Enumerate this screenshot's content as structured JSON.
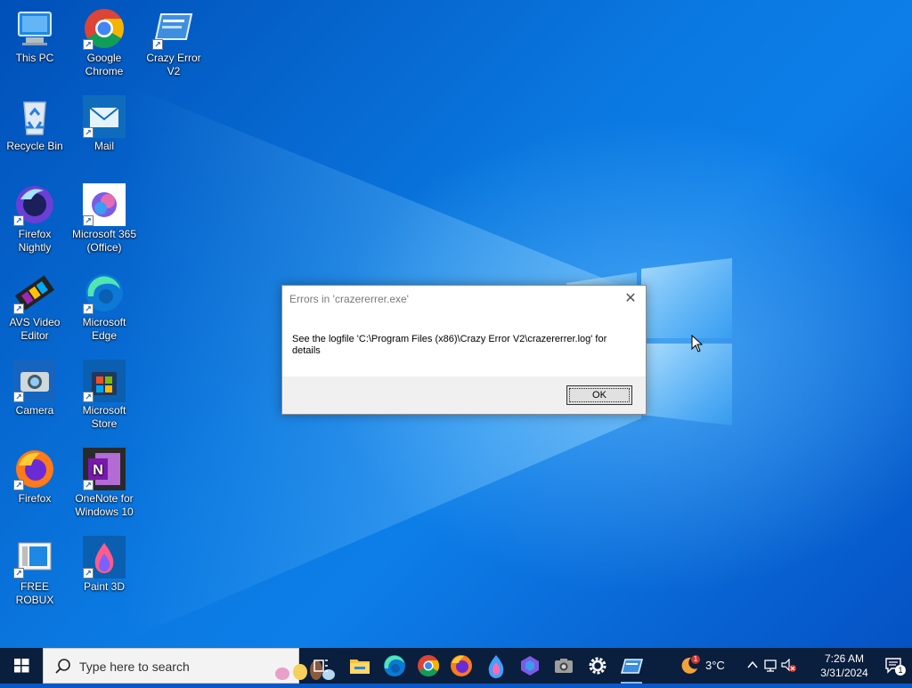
{
  "desktop": {
    "icons": [
      {
        "label": "This PC",
        "icon": "computer-icon",
        "shortcut": false
      },
      {
        "label": "Google Chrome",
        "icon": "chrome-icon",
        "shortcut": true
      },
      {
        "label": "Crazy Error V2",
        "icon": "crazy-error-icon",
        "shortcut": true
      },
      {
        "label": "Recycle Bin",
        "icon": "recycle-bin-icon",
        "shortcut": false
      },
      {
        "label": "Mail",
        "icon": "mail-icon",
        "shortcut": true
      },
      {
        "label": "Firefox Nightly",
        "icon": "firefox-nightly-icon",
        "shortcut": true
      },
      {
        "label": "Microsoft 365 (Office)",
        "icon": "office-icon",
        "shortcut": true
      },
      {
        "label": "AVS Video Editor",
        "icon": "film-icon",
        "shortcut": true
      },
      {
        "label": "Microsoft Edge",
        "icon": "edge-icon",
        "shortcut": true
      },
      {
        "label": "Camera",
        "icon": "camera-icon",
        "shortcut": true
      },
      {
        "label": "Microsoft Store",
        "icon": "store-icon",
        "shortcut": true
      },
      {
        "label": "Firefox",
        "icon": "firefox-icon",
        "shortcut": true
      },
      {
        "label": "OneNote for Windows 10",
        "icon": "onenote-icon",
        "shortcut": true
      },
      {
        "label": "FREE ROBUX",
        "icon": "document-icon",
        "shortcut": true
      },
      {
        "label": "Paint 3D",
        "icon": "paint3d-icon",
        "shortcut": true
      }
    ]
  },
  "dialog": {
    "title": "Errors in 'crazererrer.exe'",
    "message": "See the logfile 'C:\\Program Files (x86)\\Crazy Error V2\\crazererrer.log' for details",
    "ok_label": "OK",
    "close_glyph": "✕"
  },
  "taskbar": {
    "search_placeholder": "Type here to search",
    "pinned": [
      "task-view-icon",
      "file-explorer-icon",
      "edge-icon",
      "chrome-icon",
      "firefox-icon",
      "firefox-nightly-icon",
      "office-icon",
      "camera-icon",
      "settings-icon",
      "crazy-error-icon"
    ],
    "weather": {
      "temperature": "3°C",
      "badge": "1"
    },
    "clock": {
      "time": "7:26 AM",
      "date": "3/31/2024"
    },
    "notification_count": "1"
  },
  "colors": {
    "desktop_accent": "#0a78e0",
    "taskbar": "#0a1e3d",
    "dialog_footer": "#f0f0f0"
  }
}
